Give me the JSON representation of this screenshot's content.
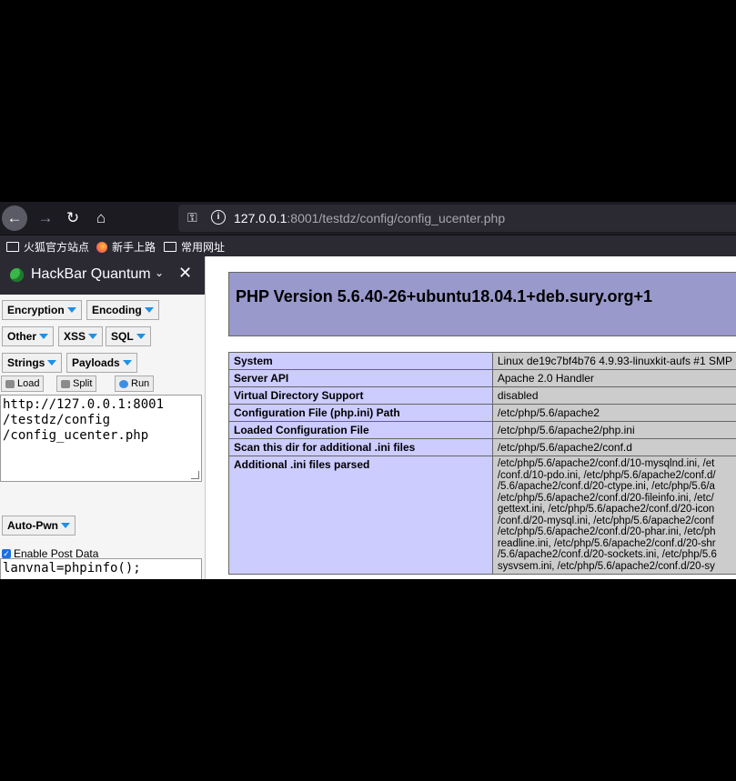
{
  "browser": {
    "url_host": "127.0.0.1",
    "url_rest": ":8001/testdz/config/config_ucenter.php",
    "bookmarks": [
      "火狐官方站点",
      "新手上路",
      "常用网址"
    ]
  },
  "hackbar": {
    "title": "HackBar Quantum",
    "menus": [
      "Encryption",
      "Encoding",
      "Other",
      "XSS",
      "SQL",
      "Strings",
      "Payloads"
    ],
    "load_label": "Load",
    "split_label": "Split",
    "run_label": "Run",
    "url_value": "http://127.0.0.1:8001\n/testdz/config\n/config_ucenter.php",
    "autopwn_label": "Auto-Pwn",
    "enable_post_label": "Enable Post Data",
    "enable_post_checked": true,
    "post_value": "lanvnal=phpinfo();"
  },
  "phpinfo": {
    "version_title": "PHP Version 5.6.40-26+ubuntu18.04.1+deb.sury.org+1",
    "rows": [
      {
        "key": "System",
        "value": "Linux de19c7bf4b76 4.9.93-linuxkit-aufs #1 SMP"
      },
      {
        "key": "Server API",
        "value": "Apache 2.0 Handler"
      },
      {
        "key": "Virtual Directory Support",
        "value": "disabled"
      },
      {
        "key": "Configuration File (php.ini) Path",
        "value": "/etc/php/5.6/apache2"
      },
      {
        "key": "Loaded Configuration File",
        "value": "/etc/php/5.6/apache2/php.ini"
      },
      {
        "key": "Scan this dir for additional .ini files",
        "value": "/etc/php/5.6/apache2/conf.d"
      }
    ],
    "additional_key": "Additional .ini files parsed",
    "additional_lines": [
      "/etc/php/5.6/apache2/conf.d/10-mysqlnd.ini, /et",
      "/conf.d/10-pdo.ini, /etc/php/5.6/apache2/conf.d/",
      "/5.6/apache2/conf.d/20-ctype.ini, /etc/php/5.6/a",
      "/etc/php/5.6/apache2/conf.d/20-fileinfo.ini, /etc/",
      "gettext.ini, /etc/php/5.6/apache2/conf.d/20-icon",
      "/conf.d/20-mysql.ini, /etc/php/5.6/apache2/conf",
      "/etc/php/5.6/apache2/conf.d/20-phar.ini, /etc/ph",
      "readline.ini, /etc/php/5.6/apache2/conf.d/20-shr",
      "/5.6/apache2/conf.d/20-sockets.ini, /etc/php/5.6",
      "sysvsem.ini, /etc/php/5.6/apache2/conf.d/20-sy"
    ]
  },
  "colors": {
    "toolbar_bg": "#1c1b22",
    "php_banner": "#9999cc",
    "php_key_bg": "#ccccff",
    "php_value_bg": "#cccccc",
    "hackbar_accent": "#1e90e6"
  }
}
